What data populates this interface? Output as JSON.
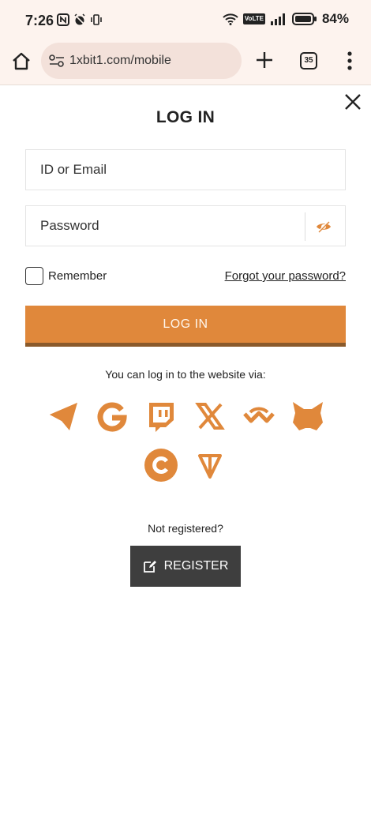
{
  "status_bar": {
    "time": "7:26",
    "network_badge": "VoLTE",
    "battery": "84%"
  },
  "browser": {
    "url": "1xbit1.com/mobile",
    "tab_count": "35"
  },
  "login": {
    "title": "LOG IN",
    "id_placeholder": "ID or Email",
    "password_placeholder": "Password",
    "remember_label": "Remember",
    "forgot_link": "Forgot your password?",
    "submit_label": "LOG IN",
    "social_prompt": "You can log in to the website via:",
    "social_providers": [
      "telegram-icon",
      "google-icon",
      "twitch-icon",
      "x-icon",
      "walletconnect-icon",
      "metamask-icon",
      "coinbase-icon",
      "ton-icon"
    ],
    "not_registered": "Not registered?",
    "register_label": "REGISTER"
  },
  "colors": {
    "accent": "#e0883b",
    "accent_dark": "#8a5a2b",
    "register_bg": "#3e3e3e",
    "browser_bg": "#fdf3ee",
    "url_bg": "#f3e1da"
  }
}
